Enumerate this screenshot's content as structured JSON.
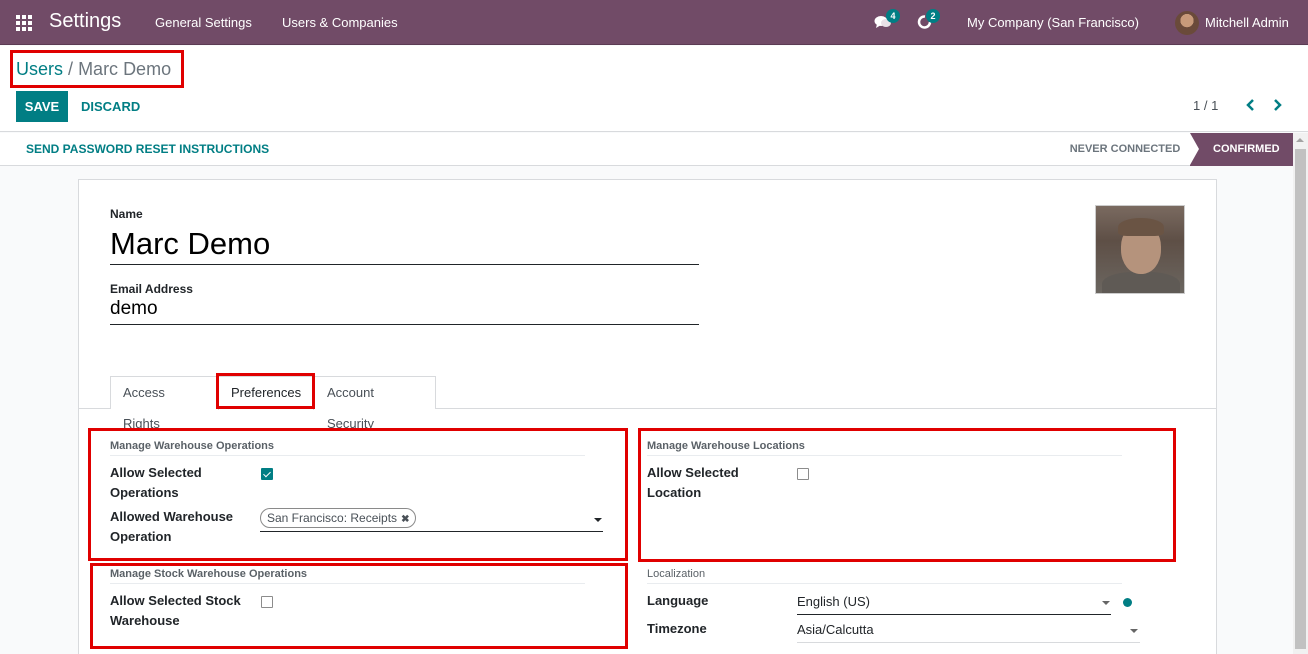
{
  "navbar": {
    "apps_icon": "apps-grid-icon",
    "brand": "Settings",
    "menu": [
      "General Settings",
      "Users & Companies"
    ],
    "messages_badge": "4",
    "activities_badge": "2",
    "company": "My Company (San Francisco)",
    "user_name": "Mitchell Admin"
  },
  "control_panel": {
    "breadcrumb": {
      "parent": "Users",
      "separator": "/",
      "current": "Marc Demo"
    },
    "save_label": "SAVE",
    "discard_label": "DISCARD",
    "pager": "1 / 1"
  },
  "statusbar": {
    "action_label": "SEND PASSWORD RESET INSTRUCTIONS",
    "stages": [
      {
        "label": "NEVER CONNECTED",
        "active": false
      },
      {
        "label": "CONFIRMED",
        "active": true
      }
    ]
  },
  "form": {
    "name_label": "Name",
    "name_value": "Marc Demo",
    "email_label": "Email Address",
    "email_value": "demo",
    "tabs": [
      {
        "label": "Access Rights",
        "active": false
      },
      {
        "label": "Preferences",
        "active": true
      },
      {
        "label": "Account Security",
        "active": false
      }
    ],
    "groups": {
      "warehouse_ops": {
        "title": "Manage Warehouse Operations",
        "allow_label_1": "Allow Selected",
        "allow_label_2": "Operations",
        "allow_checked": true,
        "allowed_label_1": "Allowed Warehouse",
        "allowed_label_2": "Operation",
        "allowed_tags": [
          "San Francisco: Receipts"
        ],
        "tag_remove": "✖"
      },
      "warehouse_locations": {
        "title": "Manage Warehouse Locations",
        "allow_label_1": "Allow Selected",
        "allow_label_2": "Location",
        "allow_checked": false
      },
      "stock_warehouse": {
        "title": "Manage Stock Warehouse Operations",
        "allow_label_1": "Allow Selected Stock",
        "allow_label_2": "Warehouse",
        "allow_checked": false
      },
      "localization": {
        "title": "Localization",
        "language_label": "Language",
        "language_value": "English (US)",
        "timezone_label": "Timezone",
        "timezone_value": "Asia/Calcutta"
      }
    }
  },
  "colors": {
    "brand": "#714b67",
    "accent": "#017e84",
    "highlight": "#e00000"
  }
}
